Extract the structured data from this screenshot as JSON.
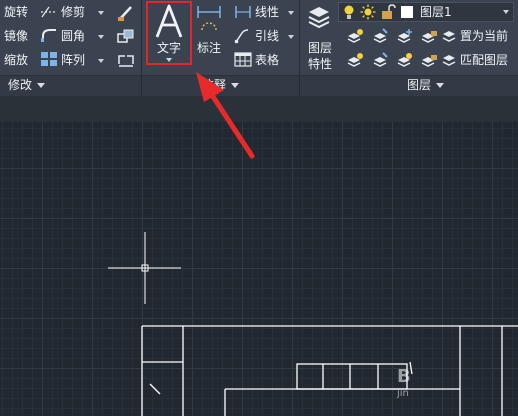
{
  "modify_panel": {
    "title": "修改",
    "rotate_label": "旋转",
    "mirror_label": "镜像",
    "scale_label": "缩放",
    "trim_label": "修剪",
    "fillet_label": "圆角",
    "array_label": "阵列"
  },
  "annotation_panel": {
    "title": "注释",
    "text_label": "文字",
    "dimension_label": "标注",
    "linear_label": "线性",
    "leader_label": "引线",
    "table_label": "表格"
  },
  "layers_panel": {
    "title": "图层",
    "layer_properties_label": "图层\n特性",
    "current_layer_name": "图层1",
    "set_current_label": "置为当前",
    "match_layer_label": "匹配图层"
  },
  "watermark": {
    "big": "B",
    "small": "jin"
  },
  "colors": {
    "ribbon_bg": "#3b4350",
    "canvas_bg": "#212830",
    "highlight": "#e02828",
    "arrow": "#e82a2a"
  }
}
